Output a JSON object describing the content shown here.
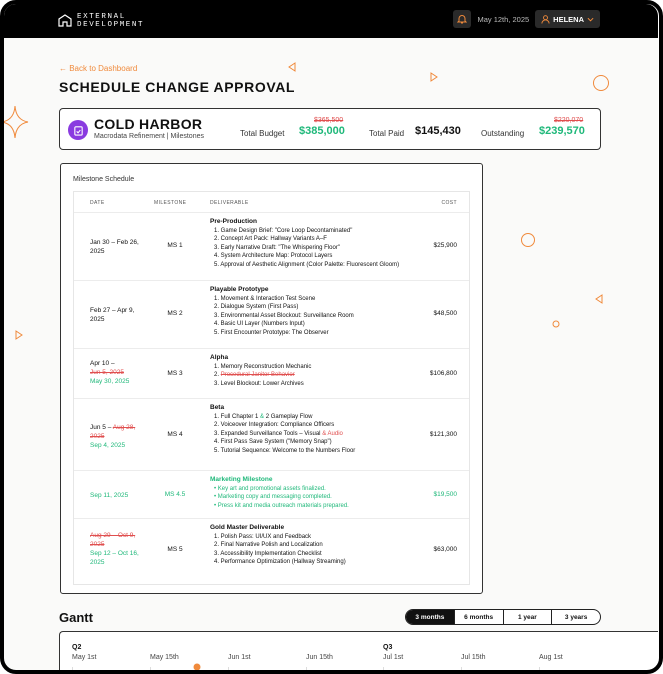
{
  "brand": {
    "line1": "EXTERNAL",
    "line2": "DEVELOPMENT"
  },
  "header": {
    "date": "May 12th, 2025",
    "user": "HELENA"
  },
  "page": {
    "back_link": "← Back to Dashboard",
    "title": "SCHEDULE CHANGE APPROVAL"
  },
  "project": {
    "name": "COLD HARBOR",
    "subtitle": "Macrodata Refinement | Milestones",
    "total_budget_label": "Total Budget",
    "total_budget_old": "$365,500",
    "total_budget": "$385,000",
    "total_paid_label": "Total Paid",
    "total_paid": "$145,430",
    "outstanding_label": "Outstanding",
    "outstanding_old": "$220,070",
    "outstanding": "$239,570"
  },
  "schedule": {
    "title": "Milestone Schedule",
    "columns": {
      "date": "DATE",
      "milestone": "MILESTONE",
      "deliverable": "DELIVERABLE",
      "cost": "COST"
    },
    "rows": [
      {
        "date": "Jan 30 – Feb 26, 2025",
        "ms": "MS 1",
        "heading": "Pre-Production",
        "items": [
          "1. Game Design Brief: \"Core Loop Decontaminated\"",
          "2. Concept Art Pack: Hallway Variants A–F",
          "3. Early Narrative Draft: \"The Whispering Floor\"",
          "4. System Architecture Map: Protocol Layers",
          "5. Approval of Aesthetic Alignment (Color Palette: Fluorescent Gloom)"
        ],
        "cost": "$25,900"
      },
      {
        "date": "Feb 27 – Apr 9, 2025",
        "ms": "MS 2",
        "heading": "Playable Prototype",
        "items": [
          "1. Movement & Interaction Test Scene",
          "2. Dialogue System (First Pass)",
          "3. Environmental Asset Blockout: Surveillance Room",
          "4. Basic UI Layer (Numbers Input)",
          "5. First Encounter Prototype: The Observer"
        ],
        "cost": "$48,500"
      },
      {
        "date_start": "Apr 10 –",
        "date_old": "Jun 5, 2025",
        "date_new": "May 30, 2025",
        "ms": "MS 3",
        "heading": "Alpha",
        "item1": "1. Memory Reconstruction Mechanic",
        "item2_prefix": "2.",
        "item2_removed": "Procedural Janitor Behavior",
        "item3": "3. Level Blockout: Lower Archives",
        "cost": "$106,800"
      },
      {
        "date_start": "Jun 5 –",
        "date_old": "Aug 28, 2025",
        "date_new": "Sep 4, 2025",
        "ms": "MS 4",
        "heading": "Beta",
        "item1_a": "1. Full Chapter 1",
        "item1_amp": "&",
        "item1_b": "2",
        "item1_c": "Gameplay Flow",
        "item2": "2. Voiceover Integration: Compliance Officers",
        "item3_a": "3. Expanded Surveillance Tools – Visual",
        "item3_b": "& Audio",
        "item4": "4. First Pass Save System (\"Memory Snap\")",
        "item5": "5. Tutorial Sequence: Welcome to the Numbers Floor",
        "cost": "$121,300"
      },
      {
        "date": "Sep 11, 2025",
        "ms": "MS 4.5",
        "heading": "Marketing Milestone",
        "items": [
          "• Key art and promotional assets finalized.",
          "• Marketing copy and messaging completed.",
          "• Press kit and media outreach materials prepared."
        ],
        "cost": "$19,500"
      },
      {
        "date_old": "Aug 29 – Oct 9, 2025",
        "date_new": "Sep 12 – Oct 16, 2025",
        "ms": "MS 5",
        "heading": "Gold Master Deliverable",
        "items": [
          "1. Polish Pass: UI/UX and Feedback",
          "2. Final Narrative Polish and Localization",
          "3. Accessibility Implementation Checklist",
          "4. Performance Optimization (Hallway Streaming)"
        ],
        "cost": "$63,000"
      }
    ]
  },
  "gantt": {
    "title": "Gantt",
    "ranges": [
      "3 months",
      "6 months",
      "1 year",
      "3 years"
    ],
    "active_range": "3 months",
    "q2": "Q2",
    "q3": "Q3",
    "dates": [
      "May 1st",
      "May 15th",
      "Jun 1st",
      "Jun 15th",
      "Jul 1st",
      "Jul 15th",
      "Aug 1st"
    ]
  },
  "colors": {
    "accent": "#f08a3c",
    "added": "#1fb87a",
    "removed": "#e04f4f",
    "project_icon": "#8a3be0"
  }
}
